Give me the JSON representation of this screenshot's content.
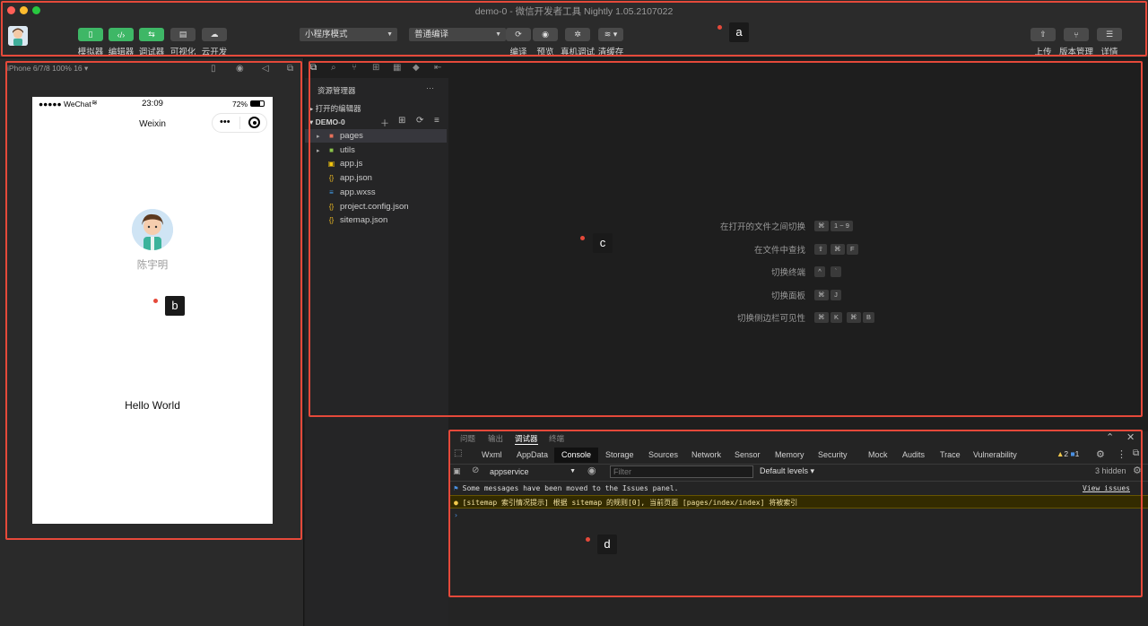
{
  "window": {
    "title": "demo-0 - 微信开发者工具 Nightly 1.05.2107022"
  },
  "toolbar": {
    "left_buttons": [
      {
        "label": "模拟器",
        "icon": "phone-icon"
      },
      {
        "label": "编辑器",
        "icon": "code-icon"
      },
      {
        "label": "调试器",
        "icon": "debug-icon"
      },
      {
        "label": "可视化",
        "icon": "layout-icon"
      },
      {
        "label": "云开发",
        "icon": "cloud-icon"
      }
    ],
    "mode_select": "小程序模式",
    "compile_select": "普通编译",
    "mid_buttons": [
      {
        "label": "编译",
        "icon": "refresh-icon"
      },
      {
        "label": "预览",
        "icon": "eye-icon"
      },
      {
        "label": "真机调试",
        "icon": "bug-icon"
      },
      {
        "label": "清缓存",
        "icon": "layers-icon"
      }
    ],
    "right_buttons": [
      {
        "label": "上传",
        "icon": "upload-icon"
      },
      {
        "label": "版本管理",
        "icon": "branch-icon"
      },
      {
        "label": "详情",
        "icon": "menu-icon"
      }
    ]
  },
  "markers": {
    "a": "a",
    "b": "b",
    "c": "c",
    "d": "d"
  },
  "simulator": {
    "device": "iPhone 6/7/8 100% 16 ▾",
    "status": {
      "carrier": "●●●●● WeChat",
      "time": "23:09",
      "battery": "72%"
    },
    "nav_title": "Weixin",
    "nickname": "陈宇明",
    "hello": "Hello World"
  },
  "explorer": {
    "title": "资源管理器",
    "more": "···",
    "open_editors": "打开的编辑器",
    "project": "DEMO-0",
    "files": [
      {
        "name": "pages",
        "icon": "folder-icon",
        "color": "#e8715a",
        "arrow": "▸"
      },
      {
        "name": "utils",
        "icon": "folder-icon",
        "color": "#8bc34a",
        "arrow": "▸"
      },
      {
        "name": "app.js",
        "icon": "js-icon",
        "color": "#f1c40f",
        "arrow": ""
      },
      {
        "name": "app.json",
        "icon": "json-icon",
        "color": "#e6b422",
        "arrow": ""
      },
      {
        "name": "app.wxss",
        "icon": "css-icon",
        "color": "#42a5f5",
        "arrow": ""
      },
      {
        "name": "project.config.json",
        "icon": "json-icon",
        "color": "#e6b422",
        "arrow": ""
      },
      {
        "name": "sitemap.json",
        "icon": "json-icon",
        "color": "#e6b422",
        "arrow": ""
      }
    ]
  },
  "editor": {
    "hints": [
      {
        "label": "在打开的文件之间切换",
        "keys": [
          "⌘",
          "1 ~ 9"
        ]
      },
      {
        "label": "在文件中查找",
        "keys": [
          "⇧",
          "⌘",
          "F"
        ]
      },
      {
        "label": "切换终端",
        "keys": [
          "^",
          "`"
        ]
      },
      {
        "label": "切换面板",
        "keys": [
          "⌘",
          "J"
        ]
      },
      {
        "label": "切换侧边栏可见性",
        "keys": [
          "⌘",
          "K",
          "⌘",
          "B"
        ]
      }
    ]
  },
  "bottom": {
    "panel_tabs": [
      "问题",
      "输出",
      "调试器",
      "终端"
    ],
    "active_panel": "调试器",
    "devtools_tabs": [
      "Wxml",
      "AppData",
      "Console",
      "Storage",
      "Sources",
      "Network",
      "Sensor",
      "Memory",
      "Security",
      "Mock",
      "Audits",
      "Trace",
      "Vulnerability"
    ],
    "active_devtool": "Console",
    "warn_count": "2",
    "info_count": "1",
    "context": "appservice",
    "filter_placeholder": "Filter",
    "levels": "Default levels ▾",
    "hidden": "3 hidden",
    "messages": [
      {
        "text": "Some messages have been moved to the Issues panel.",
        "link": "View issues"
      },
      {
        "text": "[sitemap 索引情况提示] 根据 sitemap 的规则[0], 当前页面 [pages/index/index] 将被索引"
      }
    ],
    "prompt": "›"
  }
}
